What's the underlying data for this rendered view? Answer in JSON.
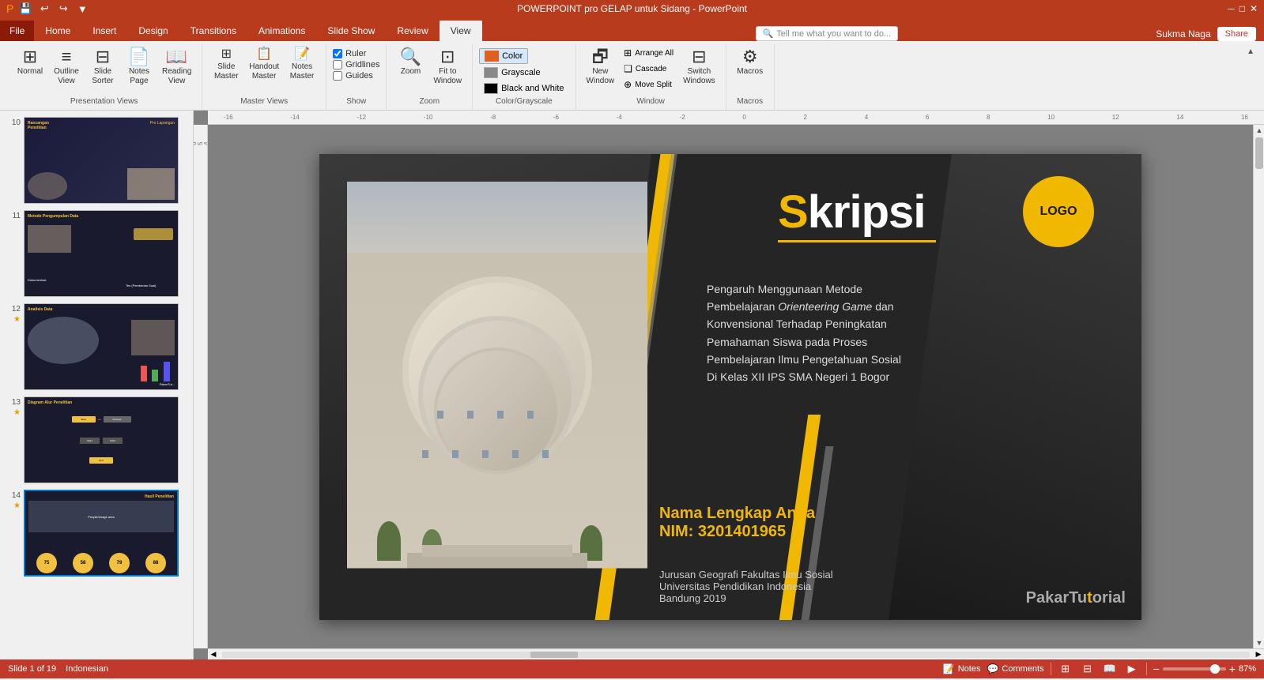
{
  "titleBar": {
    "title": "POWERPOINT pro GELAP untuk Sidang - PowerPoint",
    "controls": [
      "minimize",
      "maximize",
      "close"
    ]
  },
  "quickAccess": {
    "buttons": [
      "save",
      "undo",
      "redo",
      "customize"
    ]
  },
  "ribbonTabs": [
    {
      "id": "file",
      "label": "File"
    },
    {
      "id": "home",
      "label": "Home"
    },
    {
      "id": "insert",
      "label": "Insert"
    },
    {
      "id": "design",
      "label": "Design"
    },
    {
      "id": "transitions",
      "label": "Transitions"
    },
    {
      "id": "animations",
      "label": "Animations"
    },
    {
      "id": "slideshow",
      "label": "Slide Show"
    },
    {
      "id": "review",
      "label": "Review"
    },
    {
      "id": "view",
      "label": "View",
      "active": true
    }
  ],
  "tellMe": {
    "placeholder": "Tell me what you want to do..."
  },
  "userInfo": {
    "name": "Sukma Naga",
    "shareLabel": "Share"
  },
  "ribbonGroups": {
    "presentationViews": {
      "label": "Presentation Views",
      "buttons": [
        {
          "id": "normal",
          "label": "Normal",
          "icon": "⊞"
        },
        {
          "id": "outline",
          "label": "Outline\nView",
          "icon": "≡"
        },
        {
          "id": "slide-sorter",
          "label": "Slide\nSorter",
          "icon": "⊟"
        },
        {
          "id": "notes-page",
          "label": "Notes\nPage",
          "icon": "📄"
        },
        {
          "id": "reading-view",
          "label": "Reading\nView",
          "icon": "📖"
        }
      ]
    },
    "masterViews": {
      "label": "Master Views",
      "buttons": [
        {
          "id": "slide-master",
          "label": "Slide\nMaster",
          "icon": "⊞"
        },
        {
          "id": "handout-master",
          "label": "Handout\nMaster",
          "icon": "📋"
        },
        {
          "id": "notes-master",
          "label": "Notes\nMaster",
          "icon": "📝"
        }
      ]
    },
    "show": {
      "label": "Show",
      "checkboxes": [
        {
          "id": "ruler",
          "label": "Ruler",
          "checked": true
        },
        {
          "id": "gridlines",
          "label": "Gridlines",
          "checked": false
        },
        {
          "id": "guides",
          "label": "Guides",
          "checked": false
        }
      ]
    },
    "zoom": {
      "label": "Zoom",
      "buttons": [
        {
          "id": "zoom",
          "label": "Zoom",
          "icon": "🔍"
        },
        {
          "id": "fit-to-window",
          "label": "Fit to\nWindow",
          "icon": "⊡"
        }
      ]
    },
    "colorGrayscale": {
      "label": "Color/Grayscale",
      "options": [
        {
          "id": "color",
          "label": "Color",
          "active": true,
          "color": "#e06020"
        },
        {
          "id": "grayscale",
          "label": "Grayscale",
          "color": "#808080"
        },
        {
          "id": "black-white",
          "label": "Black and White",
          "color": "#000000"
        }
      ]
    },
    "window": {
      "label": "Window",
      "buttons": [
        {
          "id": "new-window",
          "label": "New\nWindow",
          "icon": "🗗"
        },
        {
          "id": "arrange-all",
          "label": "Arrange All",
          "icon": "⊞"
        },
        {
          "id": "cascade",
          "label": "Cascade",
          "icon": "❑"
        },
        {
          "id": "move-split",
          "label": "Move Split",
          "icon": "⊕"
        },
        {
          "id": "switch-windows",
          "label": "Switch\nWindows",
          "icon": "⊟"
        }
      ]
    },
    "macros": {
      "label": "Macros",
      "buttons": [
        {
          "id": "macros",
          "label": "Macros",
          "icon": "⚙"
        }
      ]
    }
  },
  "slides": [
    {
      "number": "10",
      "star": false,
      "title": "Rancangan Penelitian",
      "subtitle": "Pro Lapangan",
      "bg": "#1a1a2e"
    },
    {
      "number": "11",
      "star": false,
      "title": "Metode Pengumpulan Data",
      "subtitle": "",
      "bg": "#1a1a2e"
    },
    {
      "number": "12",
      "star": true,
      "title": "Analisis Data",
      "subtitle": "",
      "bg": "#1a1a2e"
    },
    {
      "number": "13",
      "star": true,
      "title": "Diagram Alur Penelitian",
      "subtitle": "",
      "bg": "#1a1a2e"
    },
    {
      "number": "14",
      "star": true,
      "title": "Hasil Penelitian",
      "subtitle": "",
      "bg": "#1a1a2e"
    }
  ],
  "mainSlide": {
    "title": "Skripsi",
    "titleLetter": "S",
    "titleRest": "kripsi",
    "logoText": "LOGO",
    "description": "Pengaruh Menggunaan Metode Pembelajaran Orienteering Game dan Konvensional Terhadap Peningkatan Pemahaman Siswa pada Proses Pembelajaran Ilmu Pengetahuan Sosial Di Kelas XII IPS SMA Negeri 1 Bogor",
    "nameLabel": "Nama Lengkap Anda",
    "nimLabel": "NIM: 3201401965",
    "institution1": "Jurusan Geografi  Fakultas Ilmu Sosial",
    "institution2": "Universitas Pendidikan Indonesia",
    "institution3": "Bandung 2019",
    "watermark": "PakarTutorial"
  },
  "statusBar": {
    "slideInfo": "Slide 1 of 19",
    "language": "Indonesian",
    "notesLabel": "Notes",
    "commentsLabel": "Comments",
    "zoomPercent": "87%",
    "plusLabel": "+",
    "minusLabel": "-"
  }
}
